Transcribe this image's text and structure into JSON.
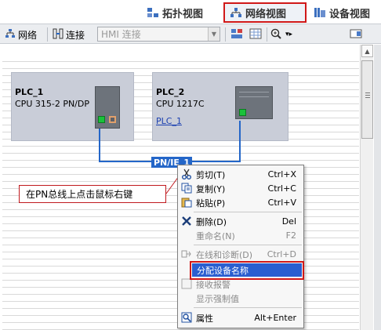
{
  "view_tabs": {
    "topology": "拓扑视图",
    "network": "网络视图",
    "device": "设备视图"
  },
  "toolbar": {
    "network_label": "网络",
    "connect_label": "连接",
    "connection_type": "HMI 连接"
  },
  "devices": [
    {
      "name": "PLC_1",
      "type": "CPU 315-2 PN/DP",
      "link": ""
    },
    {
      "name": "PLC_2",
      "type": "CPU 1217C",
      "link": "PLC_1"
    }
  ],
  "network": {
    "label": "PN/IE_1"
  },
  "callout": {
    "text": "在PN总线上点击鼠标右键"
  },
  "context_menu": {
    "items": [
      {
        "label": "剪切(T)",
        "shortcut": "Ctrl+X",
        "icon": "scissors-icon",
        "enabled": true
      },
      {
        "label": "复制(Y)",
        "shortcut": "Ctrl+C",
        "icon": "copy-icon",
        "enabled": true
      },
      {
        "label": "粘贴(P)",
        "shortcut": "Ctrl+V",
        "icon": "paste-icon",
        "enabled": true
      },
      {
        "label": "删除(D)",
        "shortcut": "Del",
        "icon": "delete-icon",
        "enabled": true
      },
      {
        "label": "重命名(N)",
        "shortcut": "F2",
        "icon": "",
        "enabled": false
      },
      {
        "label": "在线和诊断(D)",
        "shortcut": "Ctrl+D",
        "icon": "online-diagnostics-icon",
        "enabled": false
      },
      {
        "label": "分配设备名称",
        "shortcut": "",
        "icon": "",
        "enabled": true,
        "highlighted": true
      },
      {
        "label": "接收报警",
        "shortcut": "",
        "icon": "checkbox-icon",
        "enabled": false
      },
      {
        "label": "显示强制值",
        "shortcut": "",
        "icon": "",
        "enabled": false
      },
      {
        "label": "属性",
        "shortcut": "Alt+Enter",
        "icon": "properties-icon",
        "enabled": true
      }
    ]
  },
  "colors": {
    "highlight_frame": "#d01818",
    "menu_selection": "#2a5ed0",
    "network_bus": "#2466c8",
    "device_box": "#c9cdd8"
  }
}
